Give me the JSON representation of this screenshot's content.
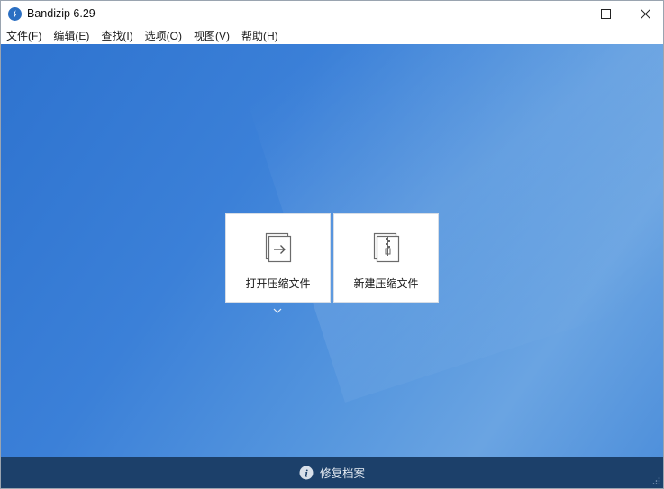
{
  "window": {
    "title": "Bandizip 6.29",
    "controls": {
      "minimize": "minimize",
      "maximize": "maximize",
      "close": "close"
    }
  },
  "menu": [
    {
      "label": "文件(F)"
    },
    {
      "label": "编辑(E)"
    },
    {
      "label": "查找(I)"
    },
    {
      "label": "选项(O)"
    },
    {
      "label": "视图(V)"
    },
    {
      "label": "帮助(H)"
    }
  ],
  "main": {
    "cards": [
      {
        "label": "打开压缩文件",
        "icon": "open-archive-icon"
      },
      {
        "label": "新建压缩文件",
        "icon": "new-archive-icon"
      }
    ],
    "dropdown_icon": "chevron-down-icon"
  },
  "statusbar": {
    "repair_label": "修复档案",
    "icon": "info-icon"
  },
  "colors": {
    "accent": "#3b80d8",
    "statusbar": "#1c406a",
    "card_bg": "#ffffff"
  }
}
